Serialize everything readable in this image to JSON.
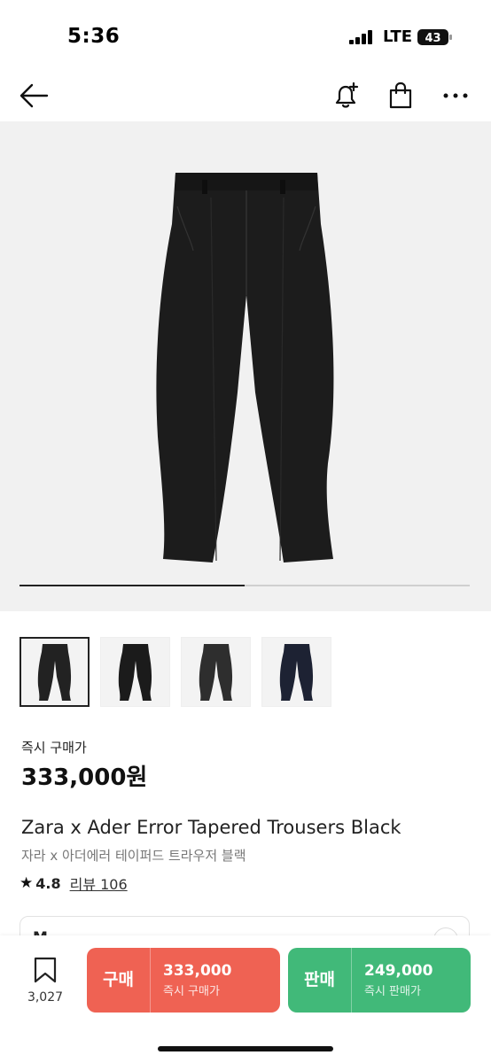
{
  "status_bar": {
    "time": "5:36",
    "network": "LTE",
    "battery": "43"
  },
  "nav": {
    "back_icon": "arrow-left-icon",
    "alert_icon": "bell-plus-icon",
    "bag_icon": "shopping-bag-icon",
    "more_icon": "more-horizontal-icon"
  },
  "gallery": {
    "progress": 0.5,
    "thumbnails": [
      {
        "color": "#222222"
      },
      {
        "color": "#1b1b1b"
      },
      {
        "color": "#2e2e2e"
      },
      {
        "color": "#1d2233"
      }
    ]
  },
  "price": {
    "label": "즉시 구매가",
    "value": "333,000원"
  },
  "product": {
    "title_en": "Zara x Ader Error Tapered Trousers Black",
    "title_ko": "자라 x 아더에러 테이퍼드 트라우저 블랙",
    "rating": "4.8",
    "review_label": "리뷰 106"
  },
  "size_selector": {
    "value": "M"
  },
  "bottom_bar": {
    "wish_count": "3,027",
    "buy": {
      "label": "구매",
      "amount": "333,000",
      "sub": "즉시 구매가",
      "color": "#ef6253"
    },
    "sell": {
      "label": "판매",
      "amount": "249,000",
      "sub": "즉시 판매가",
      "color": "#41b979"
    }
  }
}
